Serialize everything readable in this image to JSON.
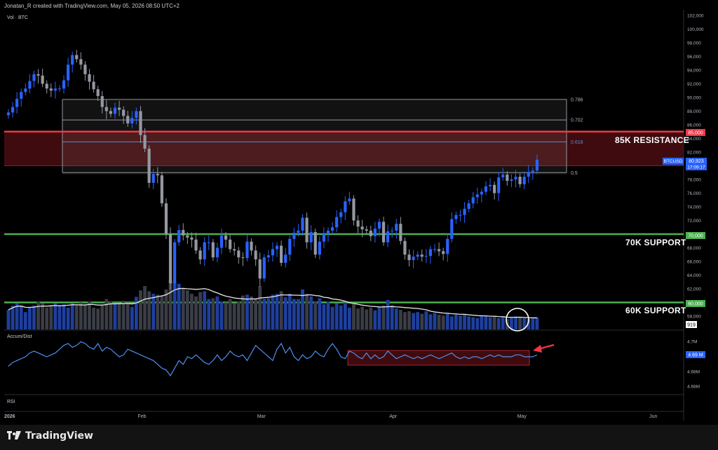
{
  "header": {
    "attribution": "Jonatan_R created with TradingView.com, May 05, 2026 08:50 UTC+2",
    "volume_label": "Vol · BTC"
  },
  "branding": {
    "name": "TradingView"
  },
  "levels": {
    "resistance_label": "85K RESISTANCE",
    "support70_label": "70K SUPPORT",
    "support60_label": "60K SUPPORT",
    "resistance_price": 85000,
    "support70_price": 70000,
    "support60_price": 60000
  },
  "fibonacci": [
    {
      "label": "0.786",
      "price": 89700
    },
    {
      "label": "0.702",
      "price": 86700
    },
    {
      "label": "0.618",
      "price": 83500
    },
    {
      "label": "0.5",
      "price": 79000
    }
  ],
  "price_tags": {
    "resistance": "85,000",
    "support70": "70,000",
    "support60": "60,000",
    "symbol": "BTCUSD",
    "last_price": "80,923",
    "countdown": "17:09:17",
    "volume_value": "919"
  },
  "indicators": {
    "accum_label": "Accum/Dist",
    "accum_value": "4.69 M",
    "rsi_label": "RSI"
  },
  "colors": {
    "bull": "#2962ff",
    "bear": "#9598a1",
    "resistance": "#f23645",
    "support": "#4caf50",
    "ad_line": "#4f8ff0"
  },
  "chart_data": {
    "type": "candlestick",
    "symbol": "BTCUSD",
    "y_axis": {
      "ticks": [
        "102,000",
        "100,000",
        "98,000",
        "96,000",
        "94,000",
        "92,000",
        "90,000",
        "88,000",
        "86,000",
        "84,000",
        "82,000",
        "80,000",
        "78,000",
        "76,000",
        "74,000",
        "72,000",
        "70,000",
        "68,000",
        "66,000",
        "64,000",
        "62,000",
        "60,000",
        "58,000"
      ],
      "range": [
        57000,
        102500
      ]
    },
    "x_axis": {
      "ticks": [
        {
          "label": "2026",
          "day": 0
        },
        {
          "label": "Feb",
          "day": 31
        },
        {
          "label": "Mar",
          "day": 59
        },
        {
          "label": "Apr",
          "day": 90
        },
        {
          "label": "May",
          "day": 120
        },
        {
          "label": "Jun",
          "day": 151
        }
      ]
    },
    "closes": [
      87800,
      88600,
      89800,
      90800,
      91300,
      92400,
      93400,
      93200,
      92000,
      91300,
      91000,
      91300,
      91300,
      92500,
      94800,
      96200,
      95600,
      94800,
      93400,
      92300,
      91200,
      90200,
      88600,
      88000,
      87600,
      88500,
      88200,
      87300,
      86200,
      87000,
      88000,
      84500,
      82500,
      77500,
      78800,
      78600,
      74500,
      70000,
      62800,
      68800,
      70600,
      69800,
      69500,
      69200,
      67600,
      66300,
      68800,
      68800,
      66600,
      68000,
      69800,
      69200,
      67800,
      67600,
      66600,
      66500,
      68900,
      67600,
      66300,
      63500,
      66600,
      66900,
      67800,
      68300,
      65800,
      67000,
      69300,
      70200,
      70500,
      72400,
      68800,
      70300,
      67000,
      68900,
      70000,
      70500,
      71000,
      72500,
      73200,
      74800,
      75200,
      72000,
      71100,
      70700,
      70500,
      69700,
      70800,
      71800,
      68800,
      70400,
      70500,
      71500,
      69000,
      67000,
      66200,
      66700,
      67000,
      66700,
      66800,
      67800,
      67800,
      67500,
      67100,
      69300,
      72200,
      72800,
      72800,
      73700,
      74500,
      75400,
      75800,
      76200,
      77000,
      77200,
      76000,
      78300,
      78700,
      77800,
      78000,
      78400,
      77300,
      78400,
      79100,
      79300,
      80900
    ],
    "colors": "candles whose close is at or above the previous close are drawn blue, others grey",
    "volume": {
      "label": "Vol · BTC",
      "values": [
        45,
        55,
        60,
        55,
        40,
        50,
        55,
        65,
        60,
        50,
        55,
        60,
        55,
        58,
        50,
        60,
        55,
        62,
        58,
        65,
        50,
        48,
        55,
        70,
        65,
        60,
        58,
        66,
        62,
        52,
        75,
        90,
        100,
        88,
        82,
        80,
        78,
        92,
        115,
        110,
        105,
        95,
        90,
        82,
        76,
        86,
        88,
        70,
        72,
        76,
        64,
        62,
        70,
        60,
        65,
        78,
        80,
        76,
        70,
        100,
        70,
        72,
        80,
        82,
        88,
        74,
        82,
        70,
        70,
        92,
        82,
        76,
        65,
        72,
        58,
        64,
        52,
        60,
        55,
        62,
        50,
        58,
        48,
        52,
        46,
        50,
        44,
        52,
        55,
        68,
        55,
        48,
        45,
        40,
        42,
        38,
        40,
        36,
        42,
        35,
        38,
        34,
        32,
        36,
        30,
        34,
        32,
        35,
        30,
        28,
        26,
        32,
        30,
        28,
        30,
        26,
        28,
        24,
        26,
        30,
        28,
        26,
        24,
        26,
        28
      ]
    },
    "accum_dist": {
      "label": "Accum/Dist",
      "ticks": [
        "4.7M",
        "4.69M",
        "4.68M",
        "4.68M"
      ],
      "values": [
        4.685,
        4.687,
        4.688,
        4.689,
        4.69,
        4.692,
        4.693,
        4.692,
        4.691,
        4.69,
        4.691,
        4.692,
        4.694,
        4.696,
        4.697,
        4.695,
        4.696,
        4.698,
        4.697,
        4.695,
        4.694,
        4.697,
        4.693,
        4.695,
        4.694,
        4.692,
        4.69,
        4.691,
        4.694,
        4.693,
        4.692,
        4.691,
        4.69,
        4.689,
        4.688,
        4.686,
        4.684,
        4.683,
        4.68,
        4.684,
        4.688,
        4.686,
        4.69,
        4.689,
        4.691,
        4.689,
        4.687,
        4.686,
        4.688,
        4.691,
        4.688,
        4.69,
        4.693,
        4.691,
        4.69,
        4.691,
        4.688,
        4.692,
        4.696,
        4.694,
        4.692,
        4.69,
        4.688,
        4.694,
        4.697,
        4.692,
        4.695,
        4.69,
        4.688,
        4.691,
        4.689,
        4.69,
        4.693,
        4.691,
        4.69,
        4.694,
        4.697,
        4.694,
        4.69,
        4.689,
        4.693,
        4.692,
        4.69,
        4.689,
        4.692,
        4.689,
        4.691,
        4.689,
        4.69,
        4.693,
        4.691,
        4.689,
        4.69,
        4.691,
        4.69,
        4.689,
        4.69,
        4.689,
        4.69,
        4.691,
        4.69,
        4.689,
        4.69,
        4.691,
        4.692,
        4.69,
        4.689,
        4.69,
        4.689,
        4.69,
        4.69,
        4.689,
        4.69,
        4.691,
        4.69,
        4.691,
        4.69,
        4.69,
        4.69,
        4.691,
        4.691,
        4.69,
        4.69,
        4.69,
        4.691
      ]
    }
  }
}
